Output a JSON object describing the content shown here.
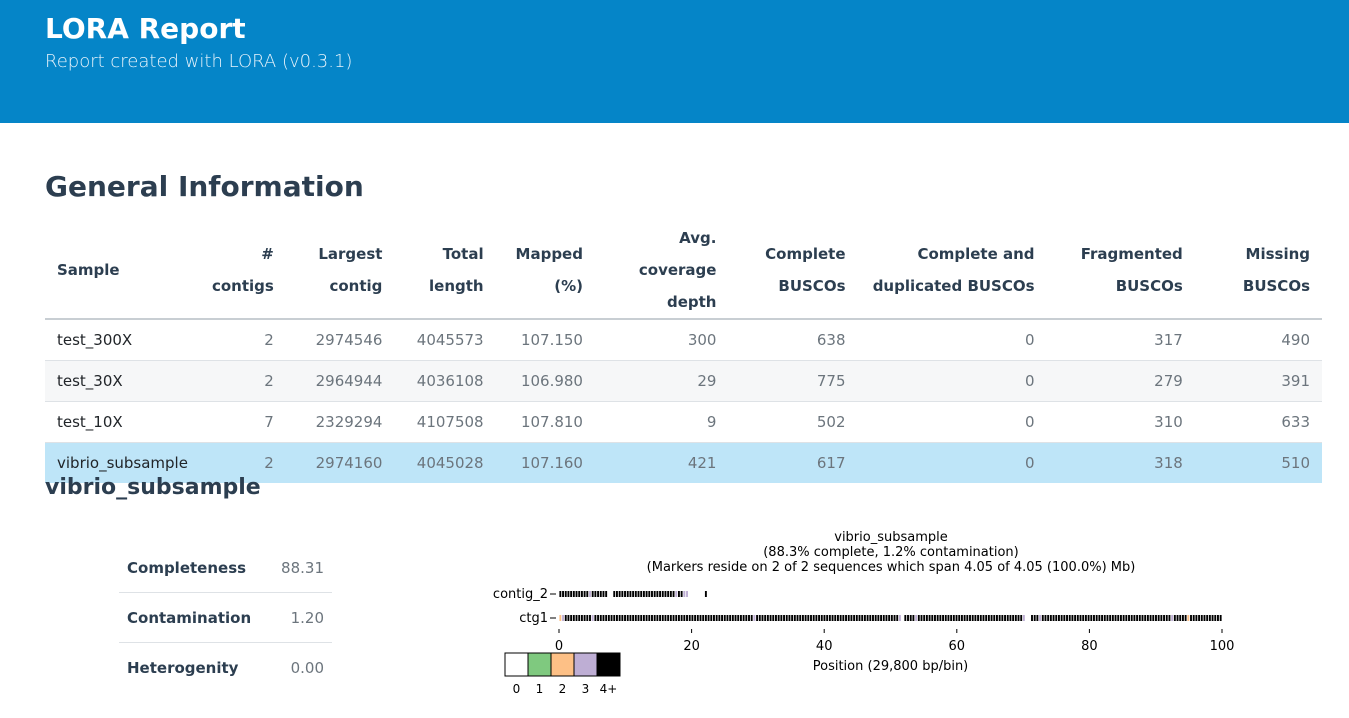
{
  "header": {
    "title": "LORA Report",
    "subtitle": "Report created with LORA (v0.3.1)"
  },
  "general": {
    "heading": "General Information",
    "columns": [
      [
        "Sample",
        ""
      ],
      [
        "#",
        "contigs"
      ],
      [
        "Largest",
        "contig"
      ],
      [
        "Total",
        "length"
      ],
      [
        "Mapped",
        "(%)"
      ],
      [
        "Avg. coverage",
        "depth"
      ],
      [
        "Complete",
        "BUSCOs"
      ],
      [
        "Complete and",
        "duplicated BUSCOs"
      ],
      [
        "Fragmented",
        "BUSCOs"
      ],
      [
        "Missing",
        "BUSCOs"
      ]
    ],
    "rows": [
      [
        "test_300X",
        "2",
        "2974546",
        "4045573",
        "107.150",
        "300",
        "638",
        "0",
        "317",
        "490"
      ],
      [
        "test_30X",
        "2",
        "2964944",
        "4036108",
        "106.980",
        "29",
        "775",
        "0",
        "279",
        "391"
      ],
      [
        "test_10X",
        "7",
        "2329294",
        "4107508",
        "107.810",
        "9",
        "502",
        "0",
        "310",
        "633"
      ],
      [
        "vibrio_subsample",
        "2",
        "2974160",
        "4045028",
        "107.160",
        "421",
        "617",
        "0",
        "318",
        "510"
      ]
    ],
    "selected_row": 3
  },
  "detail": {
    "heading": "vibrio_subsample",
    "stats": [
      {
        "label": "Completeness",
        "value": "88.31"
      },
      {
        "label": "Contamination",
        "value": "1.20"
      },
      {
        "label": "Heterogenity",
        "value": "0.00"
      }
    ]
  },
  "chart_data": {
    "type": "heatmap",
    "title": "vibrio_subsample",
    "subtitle_1": "(88.3% complete, 1.2% contamination)",
    "subtitle_2": "(Markers reside on 2 of 2 sequences which span 4.05 of 4.05 (100.0%) Mb)",
    "xlabel": "Position (29,800 bp/bin)",
    "xlim": [
      0,
      100
    ],
    "xticks": [
      "0",
      "20",
      "40",
      "60",
      "80",
      "100"
    ],
    "sequences": [
      {
        "name": "contig_2",
        "bins": [
          4,
          4,
          4,
          4,
          4,
          4,
          4,
          4,
          4,
          4,
          4,
          3,
          4,
          4,
          4,
          4,
          4,
          4,
          0,
          0,
          4,
          4,
          4,
          4,
          4,
          4,
          4,
          4,
          4,
          4,
          4,
          4,
          4,
          4,
          4,
          4,
          4,
          4,
          4,
          4,
          4,
          4,
          4,
          3,
          4,
          4,
          3,
          3,
          0,
          0,
          0,
          0,
          0,
          0,
          4
        ]
      },
      {
        "name": "ctg1",
        "bins": [
          2,
          3,
          4,
          4,
          4,
          4,
          4,
          4,
          4,
          4,
          4,
          4,
          3,
          4,
          4,
          4,
          4,
          4,
          4,
          4,
          4,
          4,
          4,
          4,
          4,
          4,
          4,
          4,
          4,
          4,
          4,
          4,
          4,
          4,
          4,
          4,
          4,
          4,
          4,
          4,
          4,
          4,
          4,
          4,
          4,
          4,
          4,
          4,
          4,
          4,
          4,
          4,
          4,
          4,
          4,
          4,
          4,
          4,
          4,
          4,
          4,
          4,
          4,
          4,
          4,
          4,
          4,
          4,
          4,
          4,
          4,
          4,
          3,
          4,
          4,
          4,
          4,
          4,
          4,
          4,
          4,
          4,
          4,
          4,
          4,
          4,
          4,
          4,
          4,
          4,
          4,
          4,
          4,
          4,
          4,
          4,
          4,
          4,
          4,
          4,
          4,
          4,
          4,
          4,
          4,
          4,
          4,
          4,
          4,
          4,
          4,
          4,
          4,
          4,
          4,
          4,
          4,
          4,
          4,
          4,
          4,
          4,
          4,
          4,
          4,
          4,
          3,
          0,
          4,
          4,
          4,
          4,
          3,
          4,
          4,
          4,
          4,
          4,
          4,
          4,
          4,
          4,
          4,
          4,
          4,
          4,
          4,
          4,
          4,
          4,
          4,
          4,
          4,
          4,
          4,
          4,
          4,
          4,
          4,
          4,
          4,
          4,
          4,
          4,
          4,
          4,
          4,
          4,
          4,
          4,
          4,
          4,
          3,
          0,
          0,
          4,
          4,
          4,
          3,
          4,
          4,
          4,
          4,
          4,
          4,
          4,
          4,
          4,
          4,
          4,
          4,
          4,
          4,
          4,
          4,
          4,
          4,
          4,
          4,
          4,
          4,
          4,
          4,
          4,
          4,
          4,
          4,
          4,
          4,
          4,
          4,
          4,
          4,
          4,
          4,
          4,
          4,
          4,
          4,
          4,
          4,
          4,
          4,
          4,
          4,
          4,
          4,
          3,
          4,
          4,
          4,
          4,
          4,
          2,
          4,
          4,
          4,
          4,
          4,
          4,
          4,
          4,
          4,
          4,
          4,
          4
        ]
      }
    ],
    "legend": {
      "labels": [
        "0",
        "1",
        "2",
        "3",
        "4+"
      ],
      "colors": [
        "#ffffff",
        "#7fc97f",
        "#fdc086",
        "#beaed4",
        "#000000"
      ]
    }
  }
}
